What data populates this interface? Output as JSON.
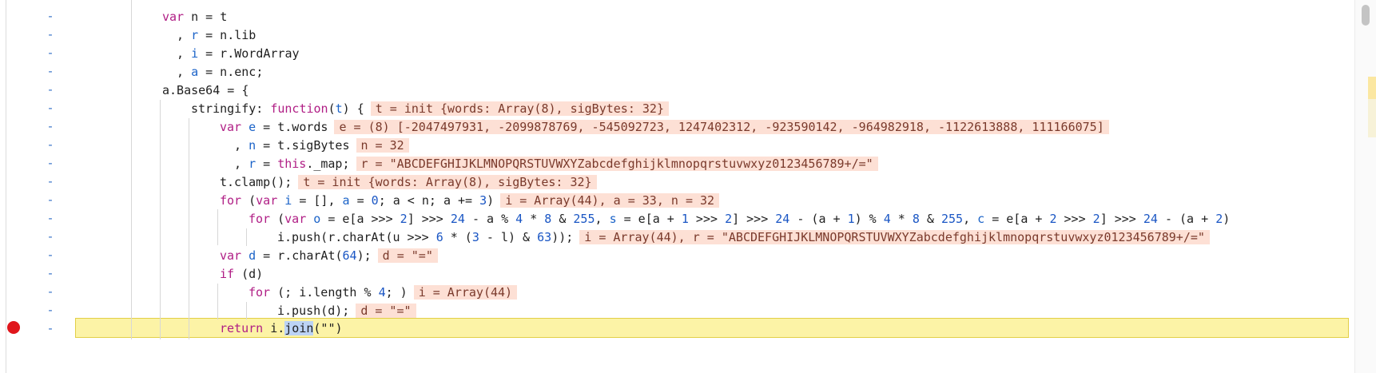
{
  "editor": {
    "gutter_mark": "-",
    "lines": {
      "l1": {
        "a": "var",
        "b": " n = t"
      },
      "l2": {
        "a": ", ",
        "b": "r",
        "c": " = n.lib"
      },
      "l3": {
        "a": ", ",
        "b": "i",
        "c": " = r.WordArray"
      },
      "l4": {
        "a": ", ",
        "b": "a",
        "c": " = n.enc;"
      },
      "l5": {
        "a": "a.Base64 = {"
      },
      "l6": {
        "a": "stringify: ",
        "b": "function",
        "c": "(",
        "d": "t",
        "e": ") {",
        "hint": "t = init {words: Array(8), sigBytes: 32}"
      },
      "l7": {
        "a": "var",
        "b": " ",
        "c": "e",
        "d": " = t.words",
        "hint": "e = (8) [-2047497931, -2099878769, -545092723, 1247402312, -923590142, -964982918, -1122613888, 111166075]"
      },
      "l8": {
        "a": ", ",
        "b": "n",
        "c": " = t.sigBytes",
        "hint": "n = 32"
      },
      "l9": {
        "a": ", ",
        "b": "r",
        "c": " = ",
        "d": "this",
        "e": "._map;",
        "hint": "r = \"ABCDEFGHIJKLMNOPQRSTUVWXYZabcdefghijklmnopqrstuvwxyz0123456789+/=\""
      },
      "l10": {
        "a": "t.clamp();",
        "hint": "t = init {words: Array(8), sigBytes: 32}"
      },
      "l11": {
        "a": "for",
        "b": " (",
        "c": "var",
        "d": " ",
        "e": "i",
        "f": " = [], ",
        "g": "a",
        "h": " = ",
        "i": "0",
        "j": "; a < n; a += ",
        "k": "3",
        "l": ")",
        "hint": "i = Array(44), a = 33, n = 32"
      },
      "l12": {
        "a": "for",
        "b": " (",
        "c": "var",
        "d": " ",
        "e": "o",
        "f": " = e[a >>> ",
        "g": "2",
        "h": "] >>> ",
        "i": "24",
        "j": " - a % ",
        "k": "4",
        "l": " * ",
        "m": "8",
        "n": " & ",
        "o": "255",
        "p": ", ",
        "q": "s",
        "r": " = e[a + ",
        "s": "1",
        "t": " >>> ",
        "u": "2",
        "v": "] >>> ",
        "w": "24",
        "x": " - (a + ",
        "y": "1",
        "z": ") % ",
        "aa": "4",
        "ab": " * ",
        "ac": "8",
        "ad": " & ",
        "ae": "255",
        "af": ", ",
        "ag": "c",
        "ah": " = e[a + ",
        "ai": "2",
        "aj": " >>> ",
        "ak": "2",
        "al": "] >>> ",
        "am": "24",
        "an": " - (a + ",
        "ao": "2",
        "ap": ")"
      },
      "l13": {
        "a": "i.push(r.charAt(u >>> ",
        "b": "6",
        "c": " * (",
        "d": "3",
        "e": " - l) & ",
        "f": "63",
        "g": "));",
        "hint": "i = Array(44), r = \"ABCDEFGHIJKLMNOPQRSTUVWXYZabcdefghijklmnopqrstuvwxyz0123456789+/=\""
      },
      "l14": {
        "a": "var",
        "b": " ",
        "c": "d",
        "d": " = r.charAt(",
        "e": "64",
        "f": ");",
        "hint": "d = \"=\""
      },
      "l15": {
        "a": "if",
        "b": " (d)"
      },
      "l16": {
        "a": "for",
        "b": " (; i.length % ",
        "c": "4",
        "d": "; )",
        "hint": "i = Array(44)"
      },
      "l17": {
        "a": "i.push(d);",
        "hint": "d = \"=\""
      },
      "l18": {
        "a": "return",
        "b": " i.",
        "c": "join",
        "d": "(\"\")"
      }
    }
  },
  "colors": {
    "keyword": "#b01e85",
    "number": "#1a56c4",
    "identifier": "#1b63c8",
    "inline_value_bg": "#fde0d5",
    "current_line_bg": "#fcf3a6",
    "breakpoint": "#e0161c"
  }
}
